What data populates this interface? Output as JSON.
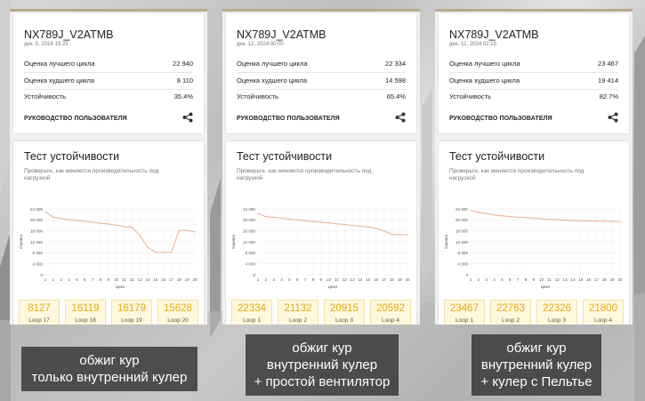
{
  "panels": [
    {
      "device": "NX789J_V2ATMB",
      "date": "дек. 5, 2024 15:23",
      "best_label": "Оценка лучшего цикла",
      "best_value": "22 940",
      "worst_label": "Оценка худшего цикла",
      "worst_value": "8 110",
      "stability_label": "Устойчивость",
      "stability_value": "35.4%",
      "guide_label": "РУКОВОДСТВО ПОЛЬЗОВАТЕЛЯ",
      "test_title": "Тест устойчивости",
      "test_desc": "Проверьте, как меняется производительность под нагрузкой",
      "scores": [
        22940,
        21000,
        20500,
        20100,
        19800,
        19500,
        19200,
        18800,
        18500,
        18100,
        17600,
        17300,
        14500,
        10000,
        8200,
        8150,
        8127,
        16119,
        16179,
        15628
      ],
      "loops": [
        {
          "value": "8127",
          "label": "Loop 17"
        },
        {
          "value": "16119",
          "label": "Loop 18"
        },
        {
          "value": "16179",
          "label": "Loop 19"
        },
        {
          "value": "15628",
          "label": "Loop 20"
        }
      ]
    },
    {
      "device": "NX789J_V2ATMB",
      "date": "дек. 12, 2024 00:00",
      "best_label": "Оценка лучшего цикла",
      "best_value": "22 334",
      "worst_label": "Оценка худшего цикла",
      "worst_value": "14 598",
      "stability_label": "Устойчивость",
      "stability_value": "65.4%",
      "guide_label": "РУКОВОДСТВО ПОЛЬЗОВАТЕЛЯ",
      "test_title": "Тест устойчивости",
      "test_desc": "Проверьте, как меняется производительность под нагрузкой",
      "scores": [
        22334,
        21132,
        20915,
        20592,
        20300,
        20000,
        19700,
        19400,
        19200,
        18900,
        18600,
        18300,
        18000,
        17700,
        17400,
        16900,
        16000,
        14700,
        14650,
        14598
      ],
      "loops": [
        {
          "value": "22334",
          "label": "Loop 1"
        },
        {
          "value": "21132",
          "label": "Loop 2"
        },
        {
          "value": "20915",
          "label": "Loop 3"
        },
        {
          "value": "20592",
          "label": "Loop 4"
        }
      ]
    },
    {
      "device": "NX789J_V2ATMB",
      "date": "дек. 12, 2024 02:19",
      "best_label": "Оценка лучшего цикла",
      "best_value": "23 467",
      "worst_label": "Оценка худшего цикла",
      "worst_value": "19 414",
      "stability_label": "Устойчивость",
      "stability_value": "82.7%",
      "guide_label": "РУКОВОДСТВО ПОЛЬЗОВАТЕЛЯ",
      "test_title": "Тест устойчивости",
      "test_desc": "Проверьте, как меняется производительность под нагрузкой",
      "scores": [
        23467,
        22763,
        22326,
        21800,
        21500,
        21200,
        21000,
        20800,
        20600,
        20400,
        20200,
        20050,
        19900,
        19800,
        19700,
        19650,
        19600,
        19500,
        19450,
        19414
      ],
      "loops": [
        {
          "value": "23467",
          "label": "Loop 1"
        },
        {
          "value": "22763",
          "label": "Loop 2"
        },
        {
          "value": "22326",
          "label": "Loop 3"
        },
        {
          "value": "21800",
          "label": "Loop 4"
        }
      ]
    }
  ],
  "chart": {
    "ylabel": "Оценка",
    "xlabel": "Цикл",
    "yticks": [
      "24 000",
      "20 000",
      "16 000",
      "12 000",
      "8 000",
      "4 000",
      "0"
    ],
    "ytick_values": [
      24000,
      20000,
      16000,
      12000,
      8000,
      4000,
      0
    ],
    "xticks": [
      "1",
      "2",
      "3",
      "4",
      "5",
      "6",
      "7",
      "8",
      "9",
      "10",
      "11",
      "12",
      "13",
      "14",
      "15",
      "16",
      "17",
      "18",
      "19",
      "20"
    ],
    "ylim": [
      0,
      24000
    ],
    "line_color": "#e8b69a",
    "loop_color": "#e6a817"
  },
  "captions": [
    {
      "line1": "обжиг кур",
      "line2": "только внутренний кулер"
    },
    {
      "line1": "обжиг кур",
      "line2": "внутренний кулер",
      "line3": "+ простой вентилятор"
    },
    {
      "line1": "обжиг кур",
      "line2": "внутренний кулер",
      "line3": "+ кулер с Пельтье"
    }
  ]
}
